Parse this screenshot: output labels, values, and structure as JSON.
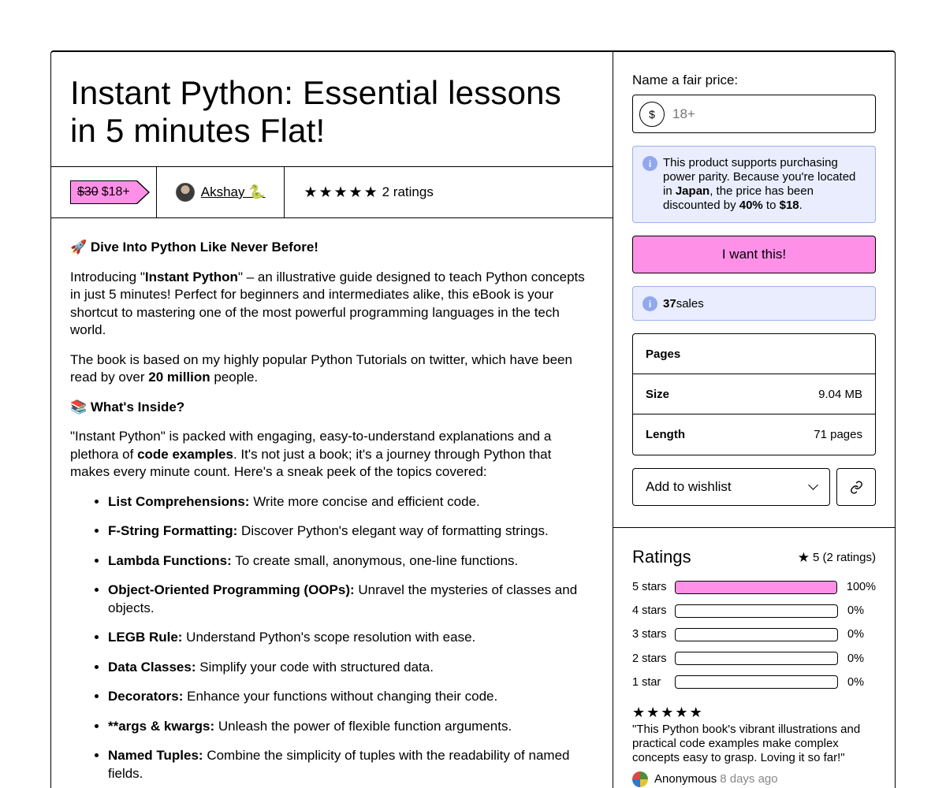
{
  "product": {
    "title": "Instant Python: Essential lessons in 5 minutes Flat!",
    "old_price": "$30",
    "price": "$18+",
    "creator": "Akshay 🐍",
    "rating_stars": 5,
    "ratings_label": "2 ratings"
  },
  "description": {
    "h1": "🚀 Dive Into Python Like Never Before!",
    "p1_a": "Introducing \"",
    "p1_bold": "Instant Python",
    "p1_b": "\" – an illustrative guide designed to teach Python concepts in just 5 minutes! Perfect for beginners and intermediates alike, this eBook is your shortcut to mastering one of the most powerful programming languages in the tech world.",
    "p2_a": "The book is based on my highly popular Python Tutorials on twitter, which have been read by over ",
    "p2_bold": "20 million",
    "p2_b": " people.",
    "h2": "📚 What's Inside?",
    "p3_a": "\"Instant Python\" is packed with engaging, easy-to-understand explanations and a plethora of ",
    "p3_bold": "code examples",
    "p3_b": ". It's not just a book; it's a journey through Python that makes every minute count. Here's a sneak peek of the topics covered:",
    "topics": [
      {
        "name": "List Comprehensions:",
        "text": " Write more concise and efficient code."
      },
      {
        "name": "F-String Formatting:",
        "text": " Discover Python's elegant way of formatting strings."
      },
      {
        "name": "Lambda Functions:",
        "text": " To create small, anonymous, one-line functions."
      },
      {
        "name": "Object-Oriented Programming (OOPs):",
        "text": " Unravel the mysteries of classes and objects."
      },
      {
        "name": "LEGB Rule:",
        "text": " Understand Python's scope resolution with ease."
      },
      {
        "name": "Data Classes:",
        "text": " Simplify your code with structured data."
      },
      {
        "name": "Decorators:",
        "text": " Enhance your functions without changing their code."
      },
      {
        "name": "**args & kwargs:",
        "text": " Unleash the power of flexible function arguments."
      },
      {
        "name": "Named Tuples:",
        "text": " Combine the simplicity of tuples with the readability of named fields."
      }
    ]
  },
  "purchase": {
    "label": "Name a fair price:",
    "currency_symbol": "$",
    "placeholder": "18+",
    "ppp_a": "This product supports purchasing power parity. Because you're located in ",
    "ppp_country": "Japan",
    "ppp_b": ", the price has been discounted by ",
    "ppp_pct": "40%",
    "ppp_c": " to ",
    "ppp_price": "$18",
    "ppp_d": ".",
    "buy_label": "I want this!",
    "sales_count": "37",
    "sales_label": " sales",
    "specs": [
      {
        "key": "Pages",
        "value": ""
      },
      {
        "key": "Size",
        "value": "9.04 MB"
      },
      {
        "key": "Length",
        "value": "71 pages"
      }
    ],
    "wishlist_label": "Add to wishlist"
  },
  "ratings": {
    "title": "Ratings",
    "summary": "5 (2 ratings)",
    "bars": [
      {
        "label": "5 stars",
        "percent": 100,
        "pct_label": "100%"
      },
      {
        "label": "4 stars",
        "percent": 0,
        "pct_label": "0%"
      },
      {
        "label": "3 stars",
        "percent": 0,
        "pct_label": "0%"
      },
      {
        "label": "2 stars",
        "percent": 0,
        "pct_label": "0%"
      },
      {
        "label": "1 star",
        "percent": 0,
        "pct_label": "0%"
      }
    ],
    "review": {
      "stars": 5,
      "text": "\"This Python book's vibrant illustrations and practical code examples make complex concepts easy to grasp. Loving it so far!\"",
      "author": "Anonymous",
      "time": "8 days ago"
    }
  },
  "colors": {
    "accent_pink": "#ff90e8",
    "info_bg": "#e9edfd",
    "info_border": "#9db0ee"
  }
}
